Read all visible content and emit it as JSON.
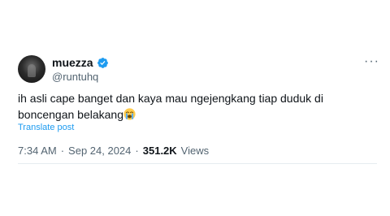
{
  "user": {
    "display_name": "muezza",
    "handle": "@runtuhq",
    "verified": true,
    "verified_color": "#1d9bf0"
  },
  "menu": {
    "more_icon": "more-horizontal-icon",
    "more_glyph": "···"
  },
  "tweet": {
    "text": "ih asli cape banget dan kaya mau ngejengkang tiap duduk di boncengan belakang",
    "emoji": "loudly-crying-face"
  },
  "translate": {
    "label": "Translate post"
  },
  "meta": {
    "time": "7:34 AM",
    "separator": "·",
    "date": "Sep 24, 2024",
    "views_count": "351.2K",
    "views_label": "Views"
  }
}
